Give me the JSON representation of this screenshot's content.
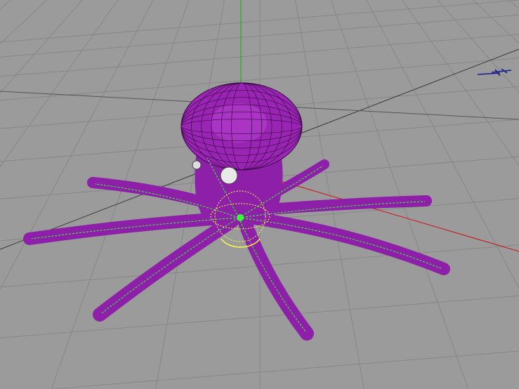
{
  "viewport": {
    "background": "#9b9b9b",
    "grid_color": "#858585",
    "axis_colors": {
      "x": "#cc1111",
      "y": "#11aa11",
      "z": "#1a1a6e"
    },
    "model_color": "#8e1fa8",
    "rig_color": "#33ff33",
    "manipulator_color": "#ffff33"
  }
}
